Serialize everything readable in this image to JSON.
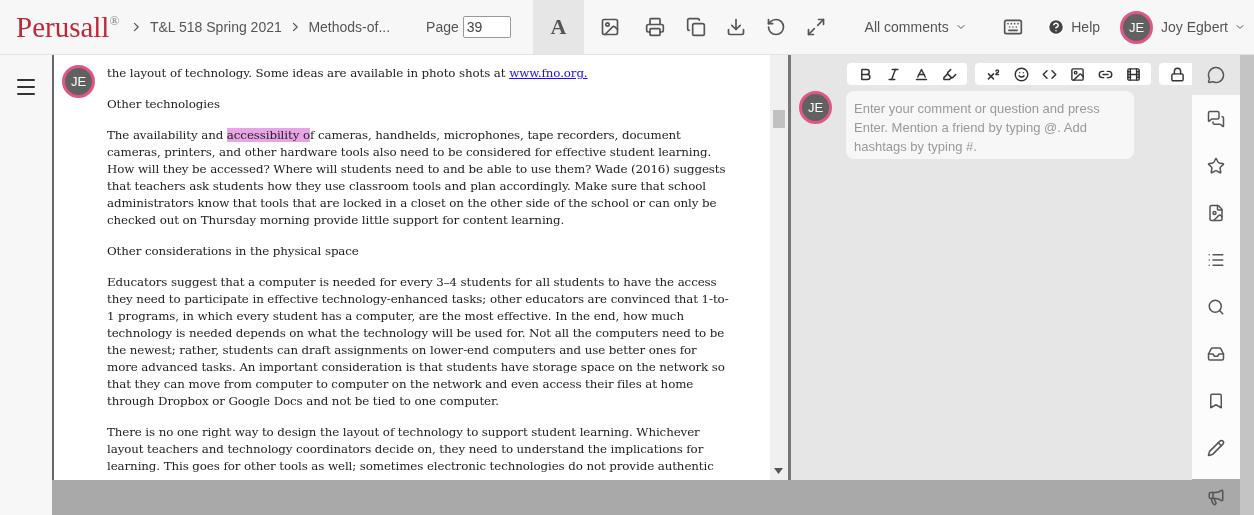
{
  "header": {
    "logo": "Perusall",
    "logo_mark": "®",
    "breadcrumbs": [
      "T&L 518 Spring 2021",
      "Methods-of..."
    ],
    "page_label": "Page",
    "page_value": "39",
    "tools": [
      {
        "kind": "text",
        "label": "A",
        "selected": true
      },
      {
        "kind": "image",
        "selected": false
      },
      {
        "kind": "print",
        "selected": false
      },
      {
        "kind": "copy",
        "selected": false
      },
      {
        "kind": "download",
        "selected": false
      },
      {
        "kind": "undo",
        "selected": false
      },
      {
        "kind": "expand",
        "selected": false
      }
    ],
    "filter": "All comments",
    "help": "Help",
    "user_initials": "JE",
    "user_name": "Joy Egbert"
  },
  "document": {
    "avatar": "JE",
    "blocks": [
      {
        "segments": [
          {
            "text": "the layout of technology. Some ideas are available in photo shots at ",
            "kind": "plain"
          },
          {
            "text": "www.fno.org.",
            "kind": "link"
          }
        ]
      },
      {
        "segments": [
          {
            "text": "Other technologies",
            "kind": "plain"
          }
        ]
      },
      {
        "segments": [
          {
            "text": "The availability and ",
            "kind": "plain"
          },
          {
            "text": "accessibility o",
            "kind": "highlight"
          },
          {
            "text": "f cameras, handhelds, microphones, tape recorders, document cameras, printers, and other hardware tools also need to be considered for effective student learning. How will they be accessed? Where will students need to and be able to use them? Wade (2016) suggests that teachers ask students how they use classroom tools and plan accordingly. Make sure that school administrators know that tools that are locked in a closet on the other side of the school or can only be checked out on Thursday morning provide little support for content learning.",
            "kind": "plain"
          }
        ]
      },
      {
        "segments": [
          {
            "text": "Other considerations in the physical space",
            "kind": "plain"
          }
        ]
      },
      {
        "segments": [
          {
            "text": "Educators suggest that a computer is needed for every 3–4 students for all students to have the access they need to participate in effective technology-enhanced tasks; other educators are convinced that 1-to-1 programs, in which every student has a computer, are the most effective. In the end, how much technology is needed depends on what the technology will be used for. Not all the computers need to be the newest; rather, students can draft assignments on lower-end computers and use better ones for more advanced tasks. An important consideration is that students have storage space on the network so that they can move from computer to computer on the network and even access their files at home through Dropbox or Google Docs and not be tied to one computer.",
            "kind": "plain"
          }
        ]
      },
      {
        "segments": [
          {
            "text": "There is no one right way to design the layout of technology to support student learning. Whichever layout teachers and technology coordinators decide on, they need to understand the implications for learning. This goes for other tools as well; sometimes electronic technologies do not provide authentic",
            "kind": "plain"
          }
        ]
      }
    ]
  },
  "comment": {
    "avatar": "JE",
    "placeholder": "Enter your comment or question and press Enter. Mention a friend by typing @. Add hashtags by typing #."
  },
  "rail": [
    {
      "kind": "comment",
      "selected": true
    },
    {
      "kind": "conversations",
      "selected": false
    },
    {
      "kind": "star",
      "selected": false
    },
    {
      "kind": "image",
      "selected": false
    },
    {
      "kind": "list",
      "selected": false
    },
    {
      "kind": "search",
      "selected": false
    },
    {
      "kind": "inbox",
      "selected": false
    },
    {
      "kind": "bookmark",
      "selected": false
    },
    {
      "kind": "pencil",
      "selected": false
    }
  ]
}
